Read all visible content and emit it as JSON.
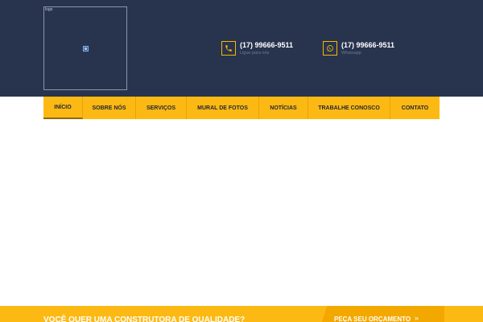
{
  "header": {
    "logo_alt": "logo",
    "contacts": [
      {
        "phone": "(17) 99666-9511",
        "label": "Ligue para nós",
        "icon": "phone-icon"
      },
      {
        "phone": "(17) 99666-9511",
        "label": "Whatsapp",
        "icon": "whatsapp-icon"
      }
    ]
  },
  "nav": {
    "items": [
      {
        "label": "INÍCIO",
        "active": true
      },
      {
        "label": "SOBRE NÓS"
      },
      {
        "label": "SERVIÇOS"
      },
      {
        "label": "MURAL DE FOTOS"
      },
      {
        "label": "NOTÍCIAS"
      },
      {
        "label": "TRABALHE CONOSCO"
      },
      {
        "label": "CONTATO"
      }
    ]
  },
  "cta": {
    "text": "VOCÊ QUER UMA CONSTRUTORA DE QUALIDADE?",
    "button_label": "PEÇA SEU ORÇAMENTO",
    "button_icon": "double-chevron-right-icon"
  },
  "colors": {
    "header_bg": "#28344e",
    "accent": "#fdb913",
    "accent_dark": "#f3a800"
  }
}
